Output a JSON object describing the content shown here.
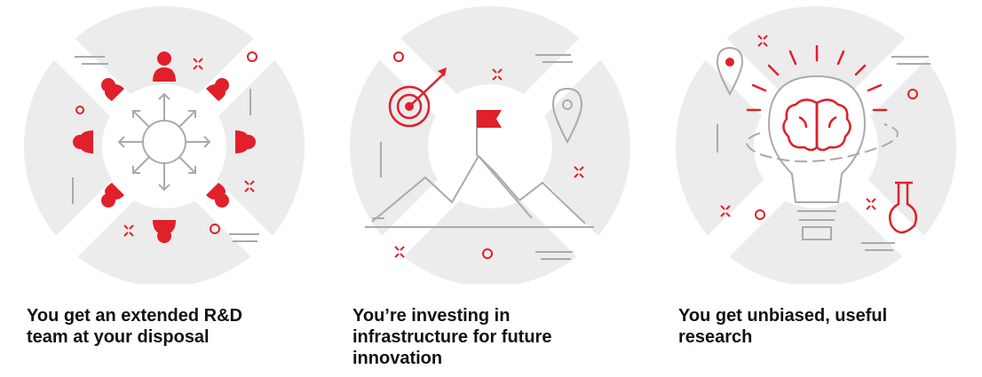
{
  "colors": {
    "accent": "#e0202a",
    "backdrop": "#ececec",
    "line": "#aaaaaa",
    "text": "#111111"
  },
  "benefits": [
    {
      "icon": "team-network-icon",
      "lines": [
        "You get an extended R&D",
        "team at your disposal"
      ]
    },
    {
      "icon": "mountain-flag-target-icon",
      "lines": [
        "You’re investing in",
        "infrastructure for future",
        "innovation"
      ]
    },
    {
      "icon": "lightbulb-brain-icon",
      "lines": [
        "You get unbiased, useful",
        "research"
      ]
    }
  ]
}
